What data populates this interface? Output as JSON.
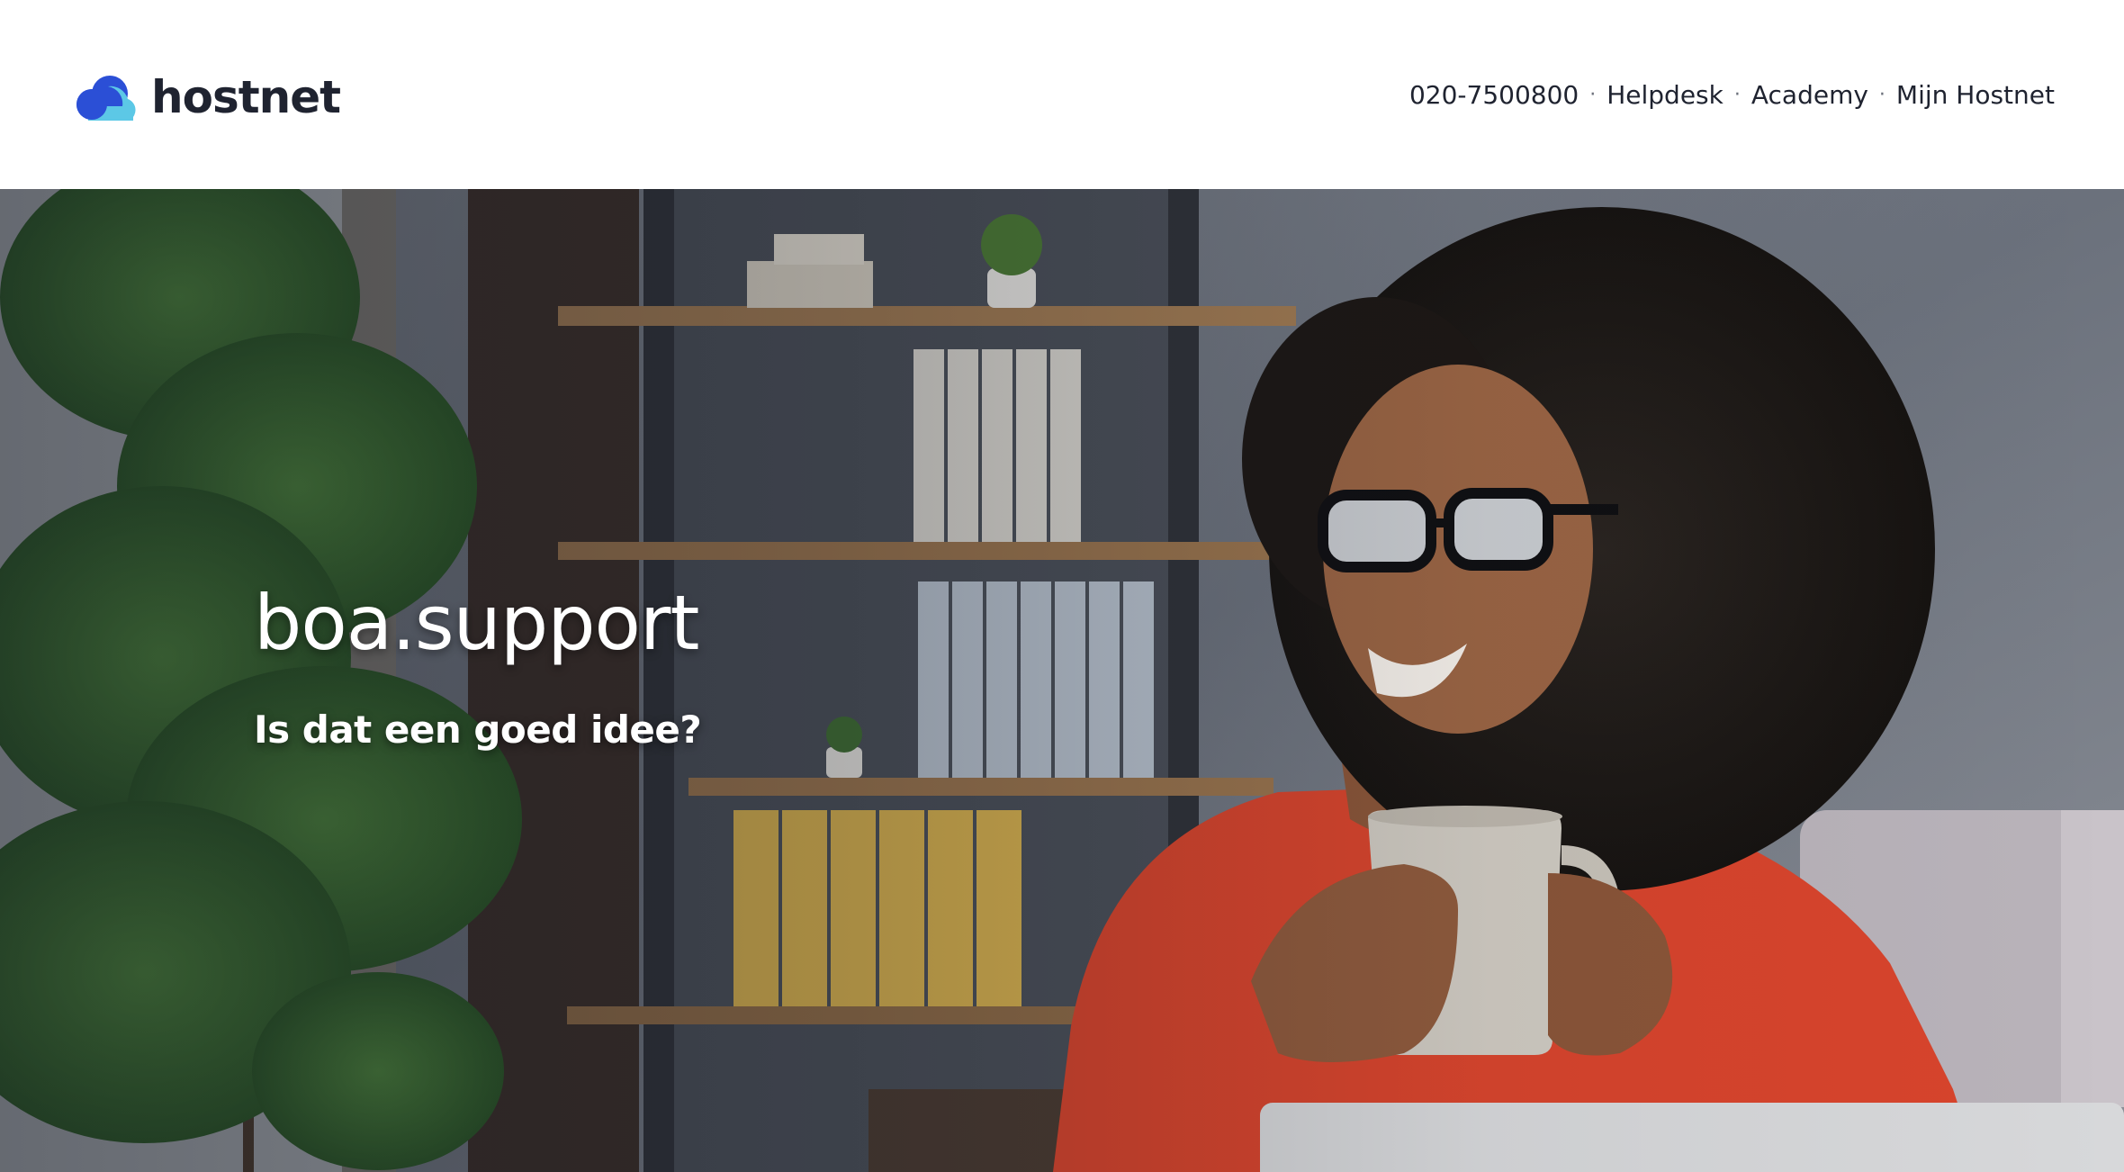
{
  "brand": {
    "name": "hostnet",
    "colors": {
      "primary": "#2b4fd6",
      "secondary": "#5cc8e6",
      "text": "#1f2330"
    }
  },
  "topnav": {
    "phone": "020-7500800",
    "separator": "·",
    "links": [
      "Helpdesk",
      "Academy",
      "Mijn Hostnet"
    ]
  },
  "hero": {
    "title": "boa.support",
    "subtitle": "Is dat een goed idee?",
    "image_subject": "smiling woman with glasses holding a mug in an office"
  }
}
